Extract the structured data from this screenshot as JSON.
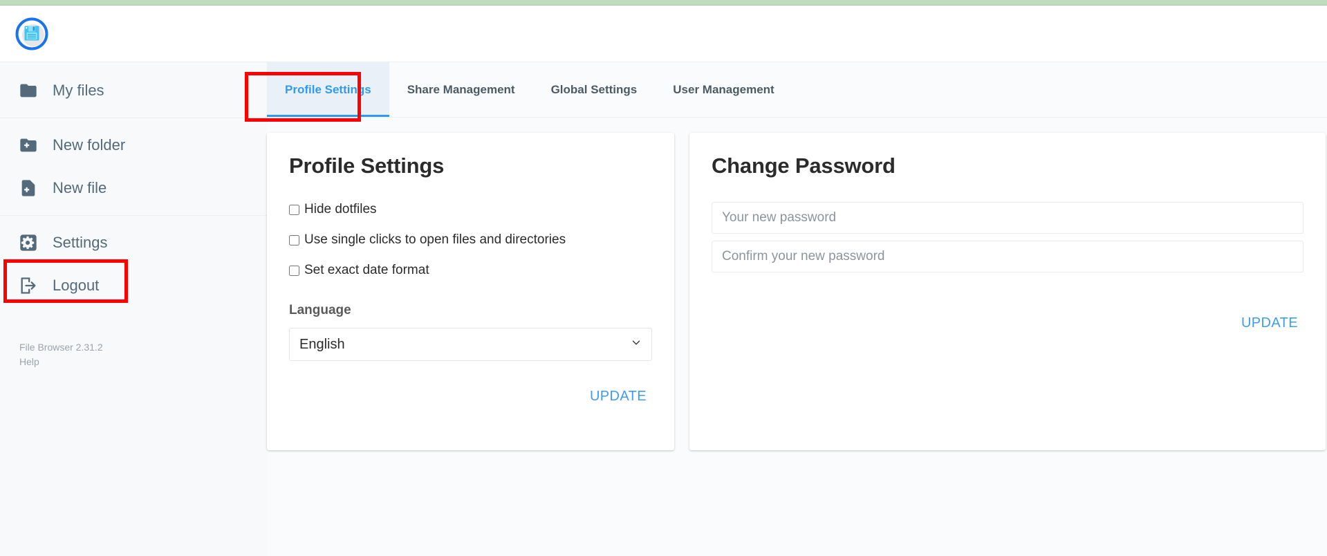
{
  "app": {
    "logo_icon": "floppy-disk-icon",
    "accent_color": "#2e9bf0",
    "top_bar_color": "#bfdcbd",
    "annotation_color": "#fe0000"
  },
  "sidebar": {
    "items": [
      {
        "label": "My files",
        "icon": "folder-icon"
      },
      {
        "label": "New folder",
        "icon": "folder-plus-icon"
      },
      {
        "label": "New file",
        "icon": "file-plus-icon"
      },
      {
        "label": "Settings",
        "icon": "gear-icon"
      },
      {
        "label": "Logout",
        "icon": "logout-icon"
      }
    ],
    "footer": {
      "version": "File Browser 2.31.2",
      "help": "Help"
    }
  },
  "tabs": [
    {
      "label": "Profile Settings",
      "active": true
    },
    {
      "label": "Share Management",
      "active": false
    },
    {
      "label": "Global Settings",
      "active": false
    },
    {
      "label": "User Management",
      "active": false
    }
  ],
  "profile_card": {
    "title": "Profile Settings",
    "checkboxes": [
      {
        "label": "Hide dotfiles",
        "checked": false
      },
      {
        "label": "Use single clicks to open files and directories",
        "checked": false
      },
      {
        "label": "Set exact date format",
        "checked": false
      }
    ],
    "language_label": "Language",
    "language_value": "English",
    "language_options": [
      "English"
    ],
    "update_label": "UPDATE"
  },
  "password_card": {
    "title": "Change Password",
    "new_password_placeholder": "Your new password",
    "new_password_value": "",
    "confirm_password_placeholder": "Confirm your new password",
    "confirm_password_value": "",
    "update_label": "UPDATE"
  }
}
